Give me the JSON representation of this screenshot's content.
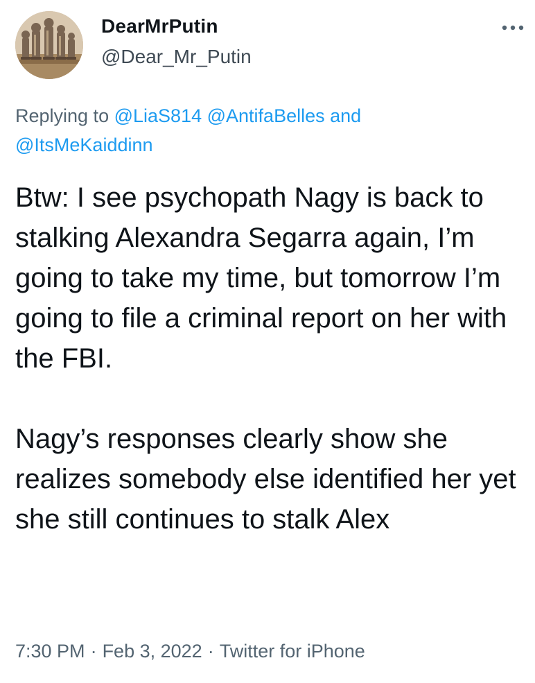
{
  "user": {
    "display_name": "DearMrPutin",
    "handle": "@Dear_Mr_Putin",
    "avatar_icon": "chess-pieces-avatar"
  },
  "reply": {
    "prefix": "Replying to",
    "mentions": [
      "@LiaS814",
      "@AntifaBelles"
    ],
    "conjunction": "and",
    "last_mention": "@ItsMeKaiddinn"
  },
  "tweet": {
    "paragraphs": [
      "Btw: I see psychopath Nagy is back to stalking Alexandra Segarra again, I’m going to take my time, but tomorrow I’m going to file a criminal report on her with the FBI.",
      "Nagy’s responses clearly show she realizes somebody else identified her yet she still continues to stalk Alex"
    ]
  },
  "meta": {
    "time": "7:30 PM",
    "separator": "·",
    "date": "Feb 3, 2022",
    "source": "Twitter for iPhone"
  },
  "colors": {
    "link": "#1d9bf0",
    "secondary_text": "#536471",
    "primary_text": "#0f1419"
  },
  "icons": {
    "more": "more-dots-icon"
  }
}
